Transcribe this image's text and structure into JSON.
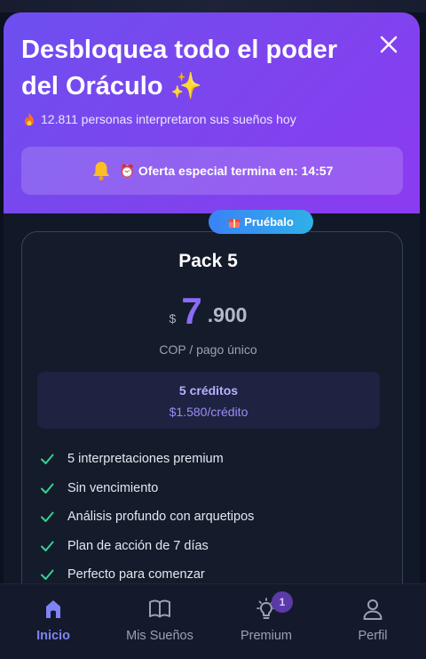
{
  "modal": {
    "title": "Desbloquea todo el poder del Oráculo ✨",
    "social_proof": "12.811 personas interpretaron sus sueños hoy",
    "offer": "⏰ Oferta especial termina en: 14:57"
  },
  "plan": {
    "badge": "Pruébalo",
    "name": "Pack 5",
    "currency_symbol": "$",
    "price_main": "7",
    "price_decimal": ".900",
    "price_note": "COP / pago único",
    "credits": "5 créditos",
    "per_credit": "$1.580/crédito",
    "features": [
      "5 interpretaciones premium",
      "Sin vencimiento",
      "Análisis profundo con arquetipos",
      "Plan de acción de 7 días",
      "Perfecto para comenzar"
    ]
  },
  "nav": {
    "tabs": [
      {
        "label": "Inicio",
        "icon": "home-icon"
      },
      {
        "label": "Mis Sueños",
        "icon": "book-icon"
      },
      {
        "label": "Premium",
        "icon": "lightbulb-icon",
        "badge": "1"
      },
      {
        "label": "Perfil",
        "icon": "user-icon"
      }
    ]
  },
  "colors": {
    "header_gradient_start": "#6d4ff0",
    "header_gradient_end": "#8b3bf0",
    "accent": "#8b6cf6",
    "check": "#34d399",
    "badge": "#3b82f6"
  }
}
